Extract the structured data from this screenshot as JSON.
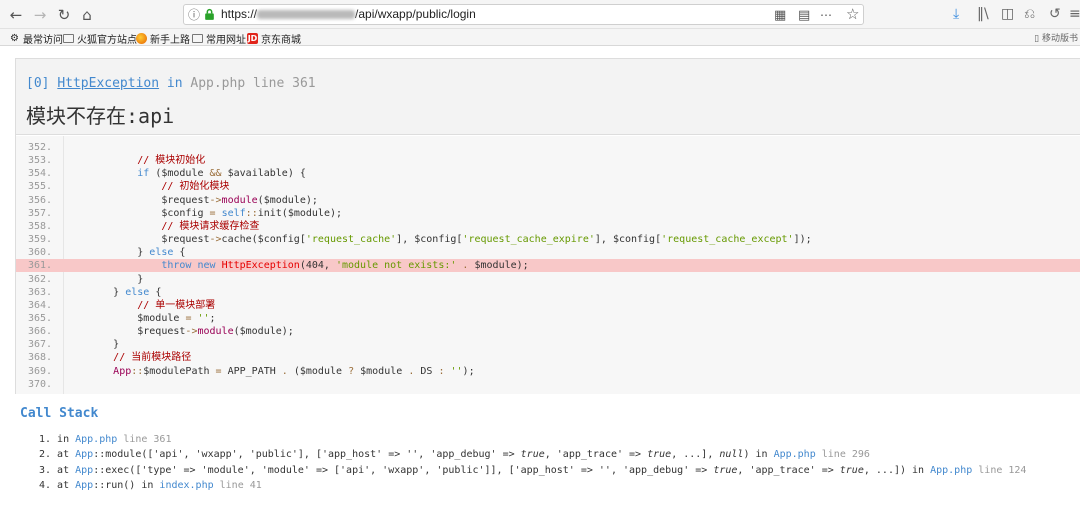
{
  "browser": {
    "url_prefix": "https://",
    "url_path": "/api/wxapp/public/login",
    "bookmarks": [
      "最常访问",
      "火狐官方站点",
      "新手上路",
      "常用网址",
      "京东商城"
    ],
    "mobile_bookmarks": "移动版书"
  },
  "exception": {
    "index": "[0]",
    "class": "HttpException",
    "in": "in",
    "file": "App.php",
    "line_word": "line",
    "line_no": "361",
    "message": "模块不存在:api"
  },
  "code_lines": [
    {
      "no": "352.",
      "html": ""
    },
    {
      "no": "353.",
      "html": "            <span class='c'>// 模块初始化</span>"
    },
    {
      "no": "354.",
      "html": "            <span class='k'>if</span> (<span class='v'>$module</span> <span class='o'>&amp;&amp;</span> <span class='v'>$available</span>) {"
    },
    {
      "no": "355.",
      "html": "                <span class='c'>// 初始化模块</span>"
    },
    {
      "no": "356.",
      "html": "                <span class='v'>$request</span><span class='o'>-&gt;</span><span class='f'>module</span>(<span class='v'>$module</span>);"
    },
    {
      "no": "357.",
      "html": "                <span class='v'>$config</span> <span class='o'>=</span> <span class='k'>self</span><span class='o'>::</span>init(<span class='v'>$module</span>);"
    },
    {
      "no": "358.",
      "html": "                <span class='c'>// 模块请求缓存检查</span>"
    },
    {
      "no": "359.",
      "html": "                <span class='v'>$request</span><span class='o'>-&gt;</span>cache(<span class='v'>$config</span>[<span class='s'>'request_cache'</span>], <span class='v'>$config</span>[<span class='s'>'request_cache_expire'</span>], <span class='v'>$config</span>[<span class='s'>'request_cache_except'</span>]);"
    },
    {
      "no": "360.",
      "html": "            } <span class='k'>else</span> {"
    },
    {
      "no": "361.",
      "html": "                <span class='k'>throw</span> <span class='k'>new</span> <span class='ku'>HttpException</span>(404, <span class='s'>'module not exists:'</span> <span class='o'>.</span> <span class='v'>$module</span>);"
    },
    {
      "no": "362.",
      "html": "            }"
    },
    {
      "no": "363.",
      "html": "        } <span class='k'>else</span> {"
    },
    {
      "no": "364.",
      "html": "            <span class='c'>// 单一模块部署</span>"
    },
    {
      "no": "365.",
      "html": "            <span class='v'>$module</span> <span class='o'>=</span> <span class='s'>''</span>;"
    },
    {
      "no": "366.",
      "html": "            <span class='v'>$request</span><span class='o'>-&gt;</span><span class='f'>module</span>(<span class='v'>$module</span>);"
    },
    {
      "no": "367.",
      "html": "        }"
    },
    {
      "no": "368.",
      "html": "        <span class='c'>// 当前模块路径</span>"
    },
    {
      "no": "369.",
      "html": "        <span class='f'>App</span><span class='o'>::</span><span class='v'>$modulePath</span> <span class='o'>=</span> APP_PATH <span class='o'>.</span> (<span class='v'>$module</span> <span class='o'>?</span> <span class='v'>$module</span> <span class='o'>.</span> DS <span class='o'>:</span> <span class='s'>''</span>);"
    },
    {
      "no": "370.",
      "html": ""
    }
  ],
  "highlight_line": "361.",
  "call_stack_title": "Call Stack",
  "call_stack": [
    "1. in <span class='blue'>App.php</span> <span class='gr'>line 361</span>",
    "2. at <span class='blue'>App</span>::module(['api', 'wxapp', 'public'], ['app_host' => '', 'app_debug' => <span class='ital'>true</span>, 'app_trace' => <span class='ital'>true</span>, ...], <span class='ital'>null</span>) in <span class='blue'>App.php</span> <span class='gr'>line 296</span>",
    "3. at <span class='blue'>App</span>::exec(['type' => 'module', 'module' => ['api', 'wxapp', 'public']], ['app_host' => '', 'app_debug' => <span class='ital'>true</span>, 'app_trace' => <span class='ital'>true</span>, ...]) in <span class='blue'>App.php</span> <span class='gr'>line 124</span>",
    "4. at <span class='blue'>App</span>::run() in <span class='blue'>index.php</span> <span class='gr'>line 41</span>"
  ]
}
